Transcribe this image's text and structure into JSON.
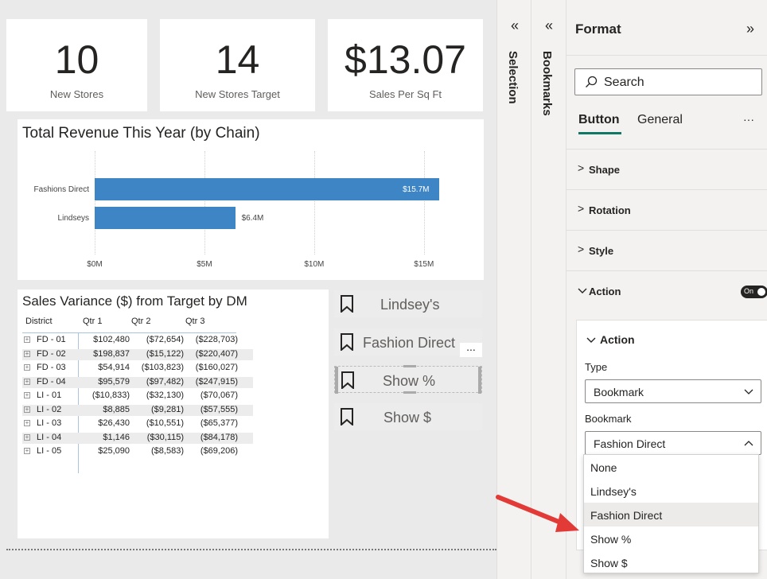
{
  "kpis": [
    {
      "value": "10",
      "label": "New Stores"
    },
    {
      "value": "14",
      "label": "New Stores Target"
    },
    {
      "value": "$13.07",
      "label": "Sales Per Sq Ft"
    }
  ],
  "chart_data": {
    "type": "bar",
    "orientation": "horizontal",
    "title": "Total Revenue This Year (by Chain)",
    "categories": [
      "Fashions Direct",
      "Lindseys"
    ],
    "values": [
      15.7,
      6.4
    ],
    "data_labels": [
      "$15.7M",
      "$6.4M"
    ],
    "x_ticks": [
      "$0M",
      "$5M",
      "$10M",
      "$15M"
    ],
    "xlim": [
      0,
      17
    ],
    "grid": true
  },
  "table": {
    "title": "Sales Variance ($) from Target by DM",
    "columns": [
      "District",
      "Qtr 1",
      "Qtr 2",
      "Qtr 3"
    ],
    "rows": [
      [
        "FD - 01",
        "$102,480",
        "($72,654)",
        "($228,703)"
      ],
      [
        "FD - 02",
        "$198,837",
        "($15,122)",
        "($220,407)"
      ],
      [
        "FD - 03",
        "$54,914",
        "($103,823)",
        "($160,027)"
      ],
      [
        "FD - 04",
        "$95,579",
        "($97,482)",
        "($247,915)"
      ],
      [
        "LI - 01",
        "($10,833)",
        "($32,130)",
        "($70,067)"
      ],
      [
        "LI - 02",
        "$8,885",
        "($9,281)",
        "($57,555)"
      ],
      [
        "LI - 03",
        "$26,430",
        "($10,551)",
        "($65,377)"
      ],
      [
        "LI - 04",
        "$1,146",
        "($30,115)",
        "($84,178)"
      ],
      [
        "LI - 05",
        "$25,090",
        "($8,583)",
        "($69,206)"
      ]
    ]
  },
  "buttons": [
    "Lindsey's",
    "Fashion Direct",
    "Show %",
    "Show $"
  ],
  "more_options": "...",
  "panes": {
    "collapse_glyph": "«",
    "selection": "Selection",
    "bookmarks": "Bookmarks"
  },
  "format": {
    "title": "Format",
    "expand_glyph": "»",
    "search_placeholder": "Search",
    "tabs": [
      "Button",
      "General"
    ],
    "tab_more": "···",
    "sections": [
      "Shape",
      "Rotation",
      "Style",
      "Action"
    ],
    "action_toggle": "On",
    "action_card_title": "Action",
    "type_label": "Type",
    "type_value": "Bookmark",
    "bookmark_label": "Bookmark",
    "bookmark_value": "Fashion Direct",
    "dropdown_options": [
      "None",
      "Lindsey's",
      "Fashion Direct",
      "Show %",
      "Show $"
    ]
  },
  "colors": {
    "bar": "#3e85c6",
    "accent": "#117865",
    "arrow": "#e23b37"
  }
}
